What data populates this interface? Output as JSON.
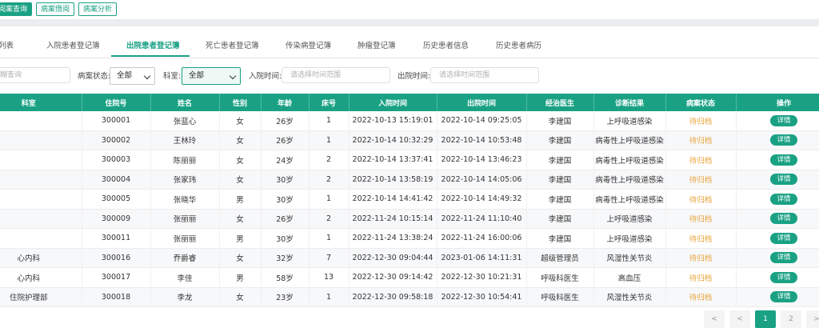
{
  "top_buttons": [
    "阅案查询",
    "病案借阅",
    "病案分析"
  ],
  "tabs": [
    "列表",
    "入院患者登记簿",
    "出院患者登记簿",
    "死亡患者登记簿",
    "传染病登记簿",
    "肿瘤登记簿",
    "历史患者信息",
    "历史患者病历"
  ],
  "filters": {
    "search_placeholder": "模糊查询",
    "status_label": "病案状态:",
    "status_value": "全部",
    "dept_label": "科室:",
    "dept_value": "全部",
    "admit_label": "入院时间:",
    "admit_placeholder": "请选择时间范围",
    "discharge_label": "出院时间:",
    "discharge_placeholder": "请选择时间范围"
  },
  "table": {
    "headers": [
      "科室",
      "住院号",
      "姓名",
      "性别",
      "年龄",
      "床号",
      "入院时间",
      "出院时间",
      "经治医生",
      "诊断结果",
      "病案状态",
      "操作"
    ],
    "rows": [
      [
        "",
        "300001",
        "张蓝心",
        "女",
        "26岁",
        "1",
        "2022-10-13 15:19:01",
        "2022-10-14 09:25:05",
        "李建国",
        "上呼吸道感染",
        "待归档",
        "详情"
      ],
      [
        "",
        "300002",
        "王林玲",
        "女",
        "26岁",
        "1",
        "2022-10-14 10:32:29",
        "2022-10-14 10:53:48",
        "李建国",
        "病毒性上呼吸道感染",
        "待归档",
        "详情"
      ],
      [
        "",
        "300003",
        "陈丽丽",
        "女",
        "24岁",
        "2",
        "2022-10-14 13:37:41",
        "2022-10-14 13:46:23",
        "李建国",
        "病毒性上呼吸道感染",
        "待归档",
        "详情"
      ],
      [
        "",
        "300004",
        "张家玮",
        "女",
        "30岁",
        "2",
        "2022-10-14 13:58:19",
        "2022-10-14 14:05:06",
        "李建国",
        "病毒性上呼吸道感染",
        "待归档",
        "详情"
      ],
      [
        "",
        "300005",
        "张晓华",
        "男",
        "30岁",
        "1",
        "2022-10-14 14:41:42",
        "2022-10-14 14:49:32",
        "李建国",
        "病毒性上呼吸道感染",
        "待归档",
        "详情"
      ],
      [
        "",
        "300009",
        "张丽丽",
        "女",
        "26岁",
        "2",
        "2022-11-24 10:15:14",
        "2022-11-24 11:10:40",
        "李建国",
        "上呼吸道感染",
        "待归档",
        "详情"
      ],
      [
        "",
        "300011",
        "张丽丽",
        "男",
        "30岁",
        "1",
        "2022-11-24 13:38:24",
        "2022-11-24 16:00:06",
        "李建国",
        "上呼吸道感染",
        "待归档",
        "详情"
      ],
      [
        "心内科",
        "300016",
        "乔爵睿",
        "女",
        "32岁",
        "7",
        "2022-12-30 09:04:44",
        "2023-01-06 14:11:31",
        "超级管理员",
        "风湿性关节炎",
        "待归档",
        "详情"
      ],
      [
        "心内科",
        "300017",
        "李佳",
        "男",
        "58岁",
        "13",
        "2022-12-30 09:14:42",
        "2022-12-30 10:21:31",
        "呼吸科医生",
        "高血压",
        "待归档",
        "详情"
      ],
      [
        "住院护理部",
        "300018",
        "李龙",
        "女",
        "23岁",
        "1",
        "2022-12-30 09:58:18",
        "2022-12-30 10:54:41",
        "呼吸科医生",
        "风湿性关节炎",
        "待归档",
        "详情"
      ]
    ]
  },
  "pagination": [
    "<",
    "<",
    "1",
    "2",
    ">"
  ],
  "colors": {
    "accent": "#1aa184",
    "status": "#e8a33a"
  }
}
